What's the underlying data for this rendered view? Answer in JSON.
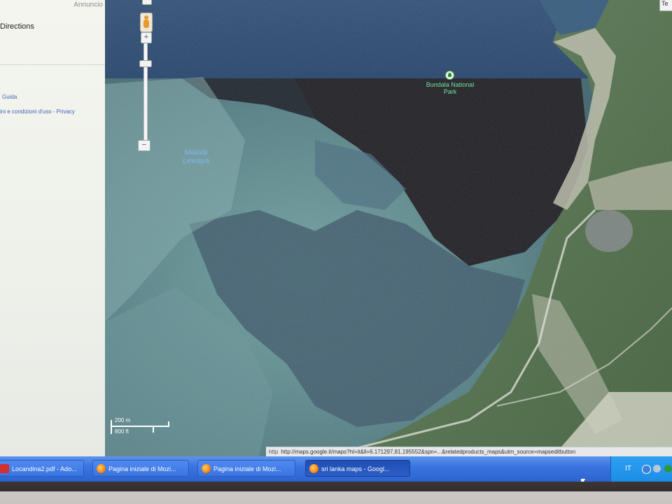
{
  "sidebar": {
    "ad_label": "Annuncio",
    "directions": "Directions",
    "guide_link": "Guida",
    "terms_link": "ini e condizioni d'uso - Privacy"
  },
  "map": {
    "park_label": "Bundala National Park",
    "lagoon_label": "Malala Lewaya",
    "scale_metric": "200 m",
    "scale_imperial": "800 ft",
    "corner_button": "Te",
    "colors": {
      "water": "#2d4a57",
      "shallow": "#5d8a8c",
      "land": "#46653b",
      "dark_water": "#1a1c22"
    }
  },
  "statusbar": {
    "prefix": "http",
    "url": "http://maps.google.it/maps?hl=it&ll=6.171297,81.195552&spn=...&relatedproducts_maps&utm_source=mapseditbutton"
  },
  "taskbar": {
    "items": [
      {
        "label": "Locandina2.pdf - Ado...",
        "icon": "pdf-icon"
      },
      {
        "label": "Pagina iniziale di Mozi...",
        "icon": "firefox-icon"
      },
      {
        "label": "Pagina iniziale di Mozi...",
        "icon": "firefox-icon"
      },
      {
        "label": "sri lanka maps - Googl...",
        "icon": "firefox-icon"
      }
    ],
    "tray": {
      "lang": "IT"
    }
  }
}
